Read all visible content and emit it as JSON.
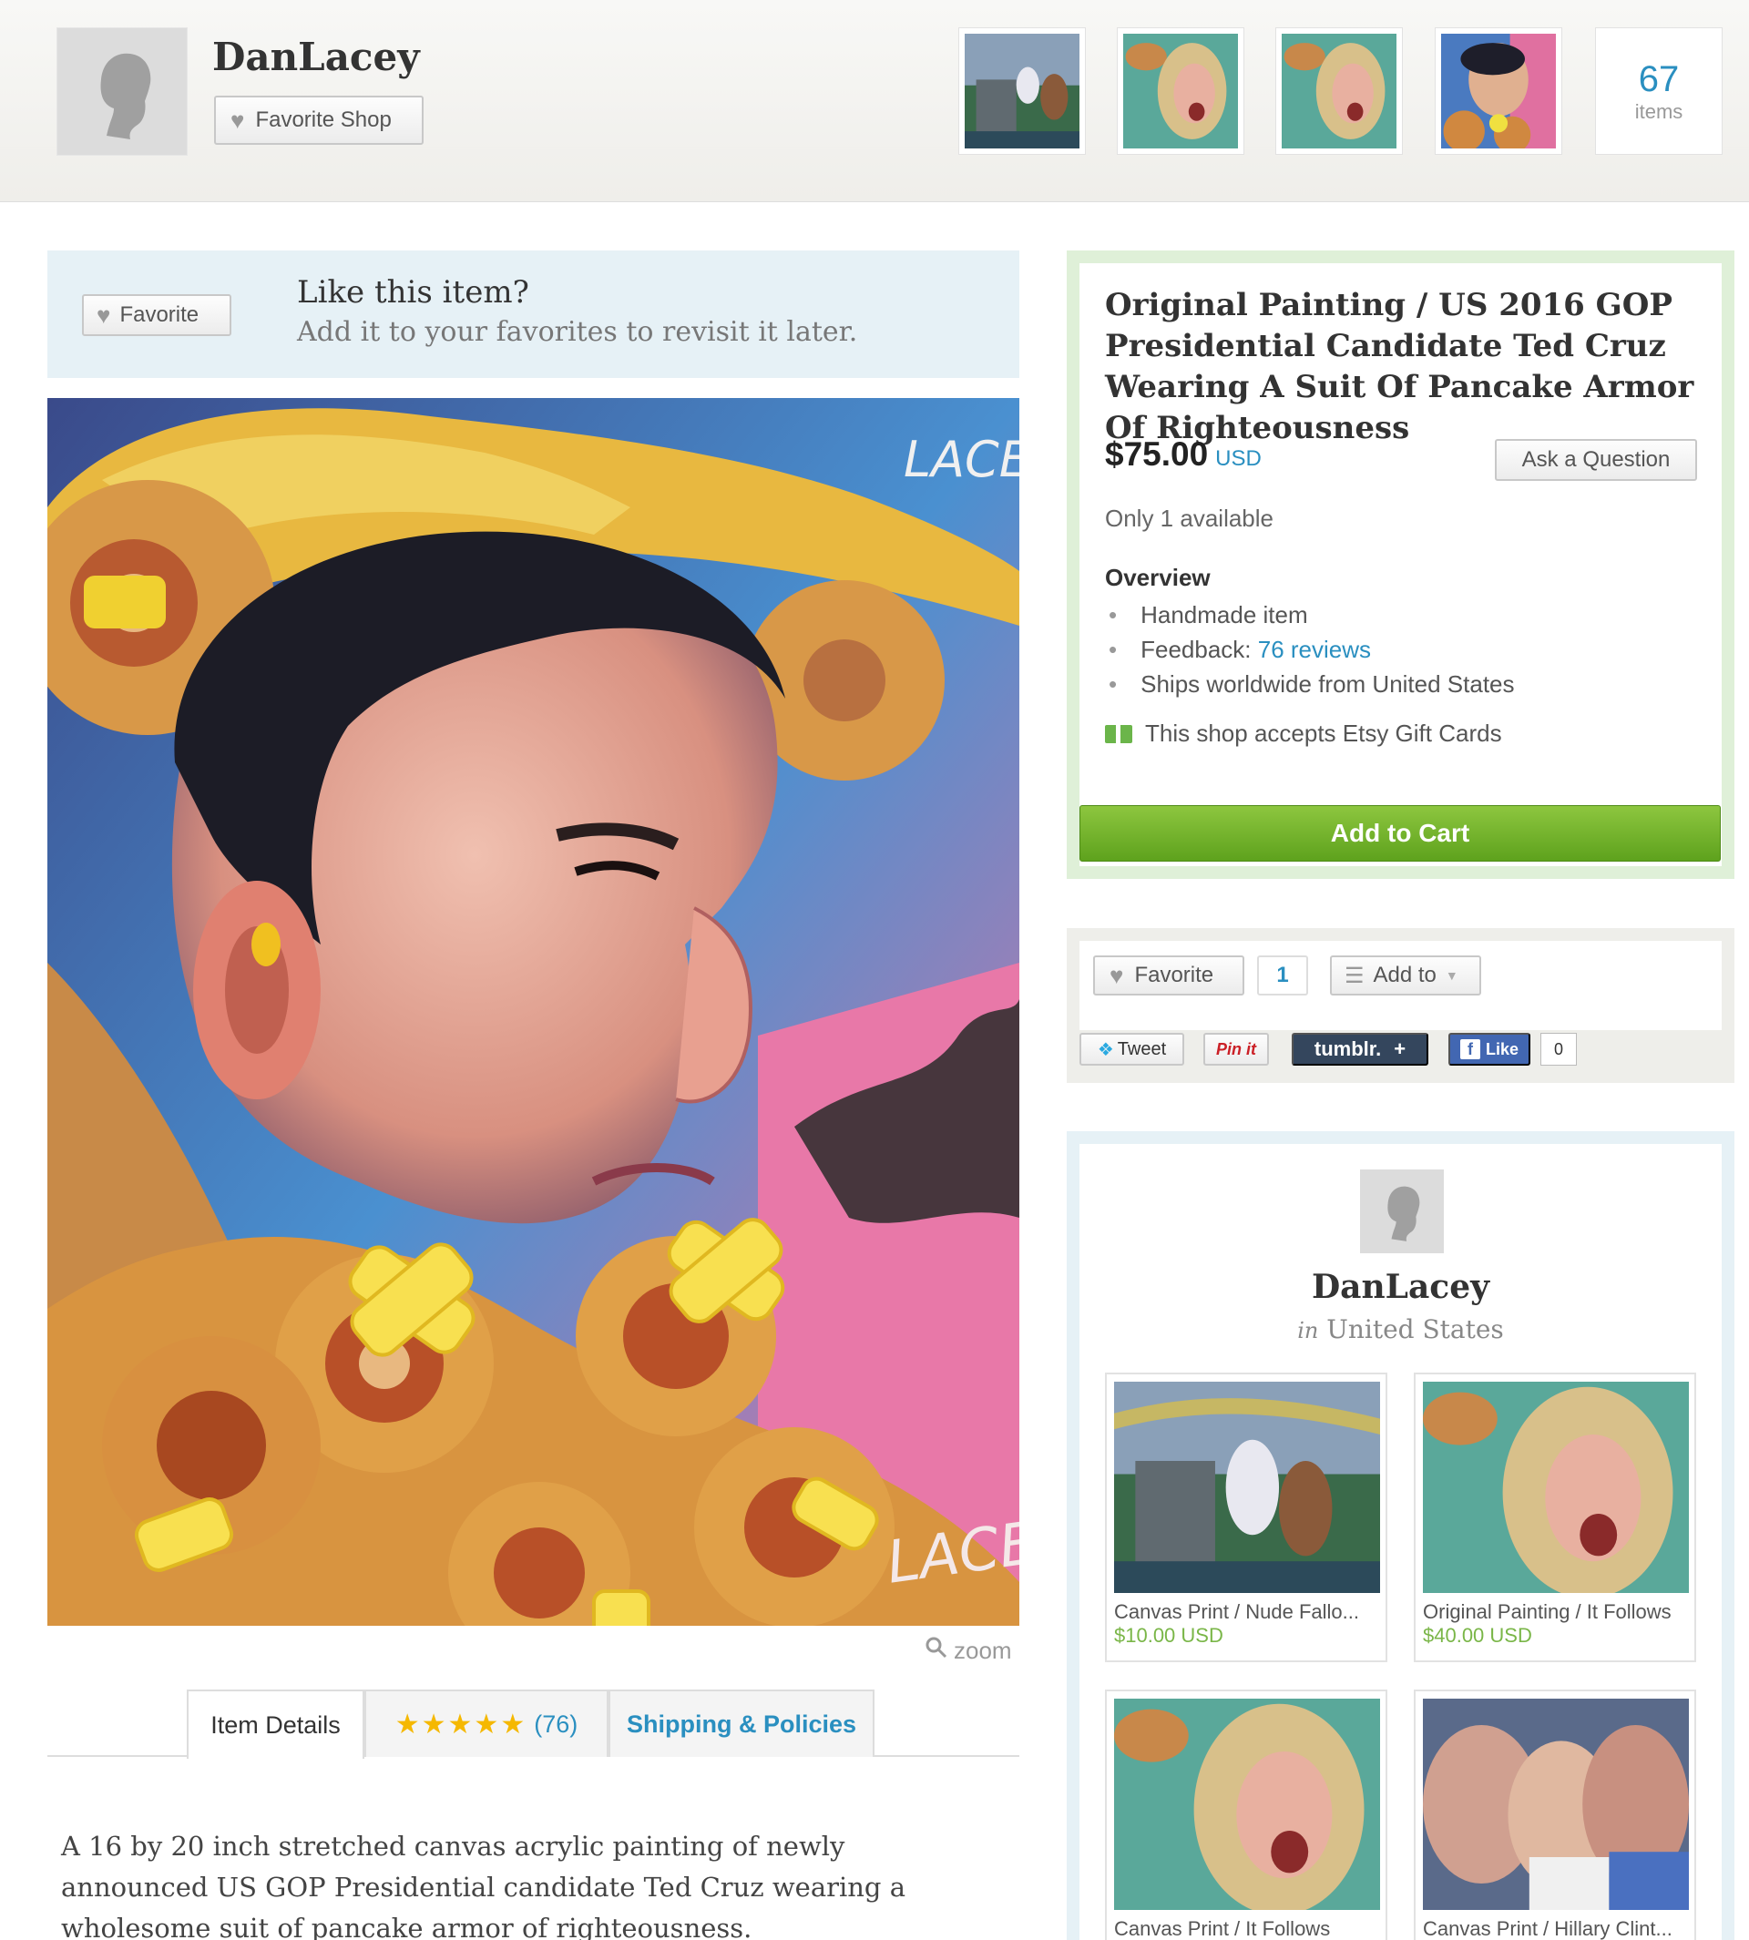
{
  "header": {
    "shop_name": "DanLacey",
    "favorite_shop_label": "Favorite Shop",
    "items_count": "67",
    "items_label": "items",
    "thumbnails": [
      "unicone-rider-thumb",
      "screaming-woman-thumb",
      "screaming-woman-thumb-2",
      "pancake-man-thumb"
    ]
  },
  "like_box": {
    "favorite_label": "Favorite",
    "title": "Like this item?",
    "subtitle": "Add it to your favorites to revisit it later."
  },
  "painting": {
    "signature_top": "LACEY",
    "signature_bottom": "LACEY"
  },
  "zoom_label": "zoom",
  "tabs": {
    "details": "Item Details",
    "stars": "★★★★★",
    "review_count": "(76)",
    "shipping": "Shipping & Policies"
  },
  "description": "A 16 by 20 inch stretched canvas acrylic painting of newly announced US GOP Presidential candidate Ted Cruz wearing a wholesome suit of pancake armor of righteousness.",
  "listing": {
    "title": "Original Painting / US 2016 GOP Presidential Candidate Ted Cruz Wearing A Suit Of Pancake Armor Of Righteousness",
    "price": "$75.00",
    "currency": "USD",
    "ask_label": "Ask a Question",
    "availability": "Only 1 available",
    "overview_title": "Overview",
    "overview_handmade": "Handmade item",
    "overview_feedback_prefix": "Feedback:",
    "overview_feedback_link": "76 reviews",
    "overview_ships": "Ships worldwide from United States",
    "gift_cards": "This shop accepts Etsy Gift Cards",
    "add_to_cart": "Add to Cart"
  },
  "social": {
    "favorite_label": "Favorite",
    "favorite_count": "1",
    "add_to_label": "Add to",
    "tweet_label": "Tweet",
    "pin_label": "Pin it",
    "tumblr_label": "tumblr.",
    "like_label": "Like",
    "like_count": "0"
  },
  "seller": {
    "name": "DanLacey",
    "location_prefix": "in",
    "location": "United States",
    "items": [
      {
        "title": "Canvas Print / Nude Fallo...",
        "price": "$10.00 USD"
      },
      {
        "title": "Original Painting / It Follows",
        "price": "$40.00 USD"
      },
      {
        "title": "Canvas Print / It Follows",
        "price": ""
      },
      {
        "title": "Canvas Print / Hillary Clint...",
        "price": ""
      }
    ]
  },
  "colors": {
    "link_blue": "#2a8fc0",
    "cart_green": "#6aab2a",
    "price_green": "#7ab648"
  }
}
